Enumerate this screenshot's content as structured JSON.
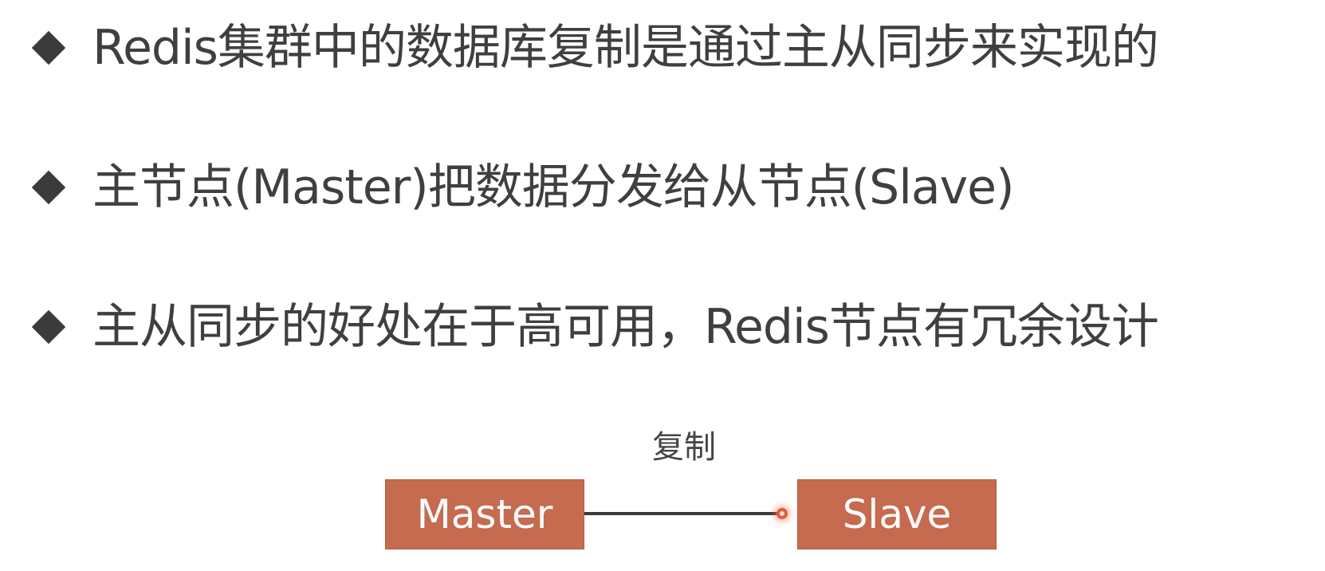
{
  "bullets": [
    "Redis集群中的数据库复制是通过主从同步来实现的",
    "主节点(Master)把数据分发给从节点(Slave)",
    "主从同步的好处在于高可用，Redis节点有冗余设计"
  ],
  "diagram": {
    "source_node": "Master",
    "target_node": "Slave",
    "edge_label": "复制",
    "node_color": "#c66a50"
  }
}
